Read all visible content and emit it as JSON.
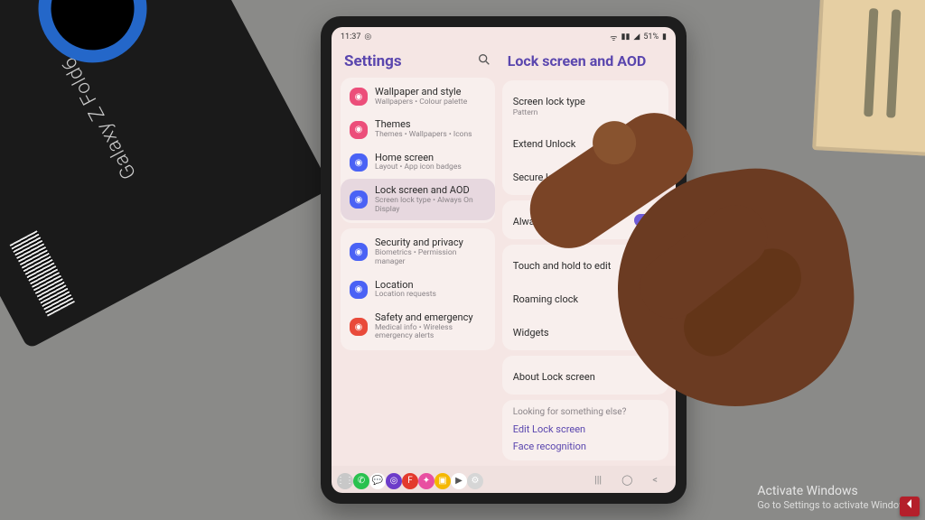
{
  "environment": {
    "box_label": "Galaxy Z Fold6"
  },
  "statusbar": {
    "time": "11:37",
    "battery_text": "51%"
  },
  "settings": {
    "title": "Settings",
    "groups": [
      {
        "items": [
          {
            "title": "Wallpaper and style",
            "subtitle": "Wallpapers • Colour palette",
            "icon": "image-icon",
            "color": "pink"
          },
          {
            "title": "Themes",
            "subtitle": "Themes • Wallpapers • Icons",
            "icon": "palette-icon",
            "color": "pink"
          },
          {
            "title": "Home screen",
            "subtitle": "Layout • App icon badges",
            "icon": "home-icon",
            "color": "blue"
          },
          {
            "title": "Lock screen and AOD",
            "subtitle": "Screen lock type • Always On Display",
            "icon": "lock-icon",
            "color": "blue",
            "selected": true
          }
        ]
      },
      {
        "items": [
          {
            "title": "Security and privacy",
            "subtitle": "Biometrics • Permission manager",
            "icon": "shield-icon",
            "color": "blue"
          },
          {
            "title": "Location",
            "subtitle": "Location requests",
            "icon": "location-icon",
            "color": "blue"
          },
          {
            "title": "Safety and emergency",
            "subtitle": "Medical info • Wireless emergency alerts",
            "icon": "sos-icon",
            "color": "red"
          }
        ]
      }
    ]
  },
  "detail": {
    "title": "Lock screen and AOD",
    "sections": [
      {
        "rows": [
          {
            "label": "Screen lock type",
            "value": "Pattern",
            "type": "link"
          },
          {
            "label": "Extend Unlock",
            "type": "link"
          },
          {
            "label": "Secure lock settings",
            "type": "link"
          }
        ]
      },
      {
        "rows": [
          {
            "label": "Always On Display",
            "type": "toggle",
            "on": true
          }
        ]
      },
      {
        "rows": [
          {
            "label": "Touch and hold to edit",
            "type": "toggle",
            "on": true
          },
          {
            "label": "Roaming clock",
            "type": "toggle",
            "on": true
          },
          {
            "label": "Widgets",
            "type": "link"
          }
        ]
      },
      {
        "rows": [
          {
            "label": "About Lock screen",
            "type": "link"
          }
        ]
      }
    ],
    "suggest": {
      "heading": "Looking for something else?",
      "links": [
        "Edit Lock screen",
        "Face recognition"
      ]
    }
  },
  "taskbar": {
    "apps": [
      {
        "name": "apps-icon",
        "bg": "#c8c8c8",
        "glyph": "⋮⋮"
      },
      {
        "name": "phone-icon",
        "bg": "#29c14e",
        "glyph": "✆"
      },
      {
        "name": "messages-icon",
        "bg": "#ffffff",
        "glyph": "💬"
      },
      {
        "name": "browser-icon",
        "bg": "#6d3cc9",
        "glyph": "◎"
      },
      {
        "name": "flipboard-icon",
        "bg": "#e33a2d",
        "glyph": "F"
      },
      {
        "name": "galaxy-store-icon",
        "bg": "#e84fa1",
        "glyph": "✦"
      },
      {
        "name": "gallery-icon",
        "bg": "#f5b800",
        "glyph": "▣"
      },
      {
        "name": "play-store-icon",
        "bg": "#ffffff",
        "glyph": "▶"
      },
      {
        "name": "settings-icon",
        "bg": "#d6d6d6",
        "glyph": "⚙"
      }
    ],
    "nav": {
      "recents": "|||",
      "home": "◯",
      "back": "<"
    }
  },
  "watermark": {
    "title": "Activate Windows",
    "subtitle": "Go to Settings to activate Windows."
  }
}
